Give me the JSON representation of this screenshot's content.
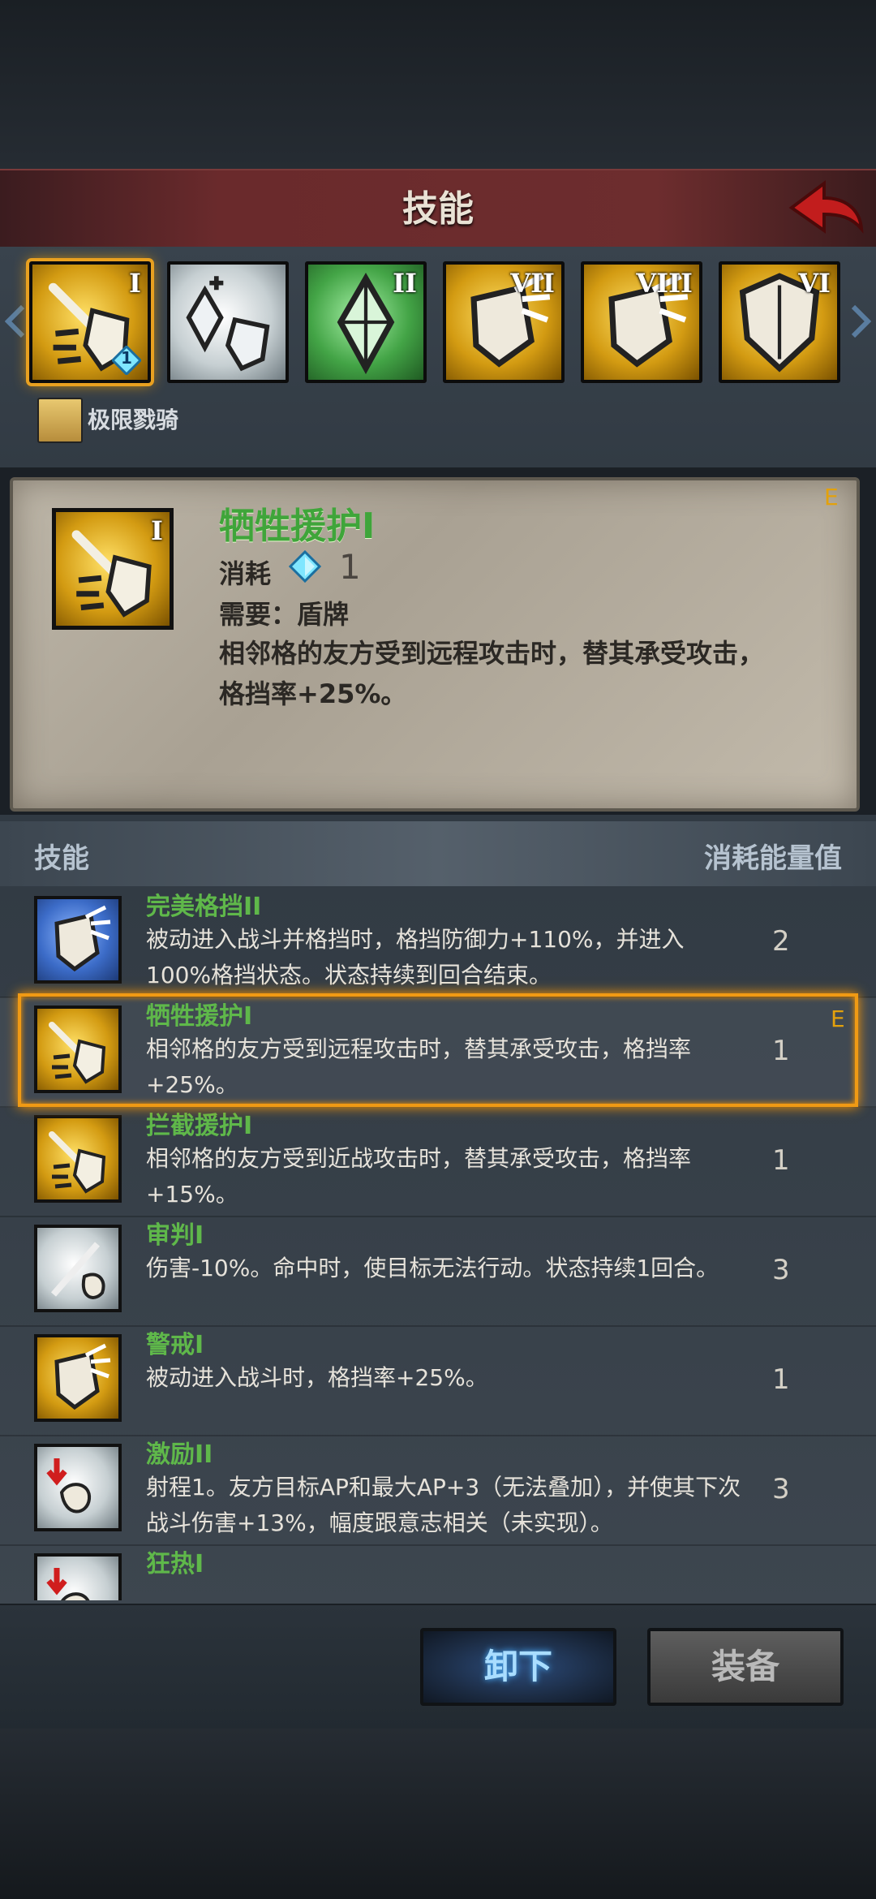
{
  "header": {
    "title": "技能"
  },
  "skill_slots": [
    {
      "roman": "I",
      "color": "yellow",
      "icon": "shield-slash-icon",
      "selected": true,
      "badge": "1"
    },
    {
      "roman": "",
      "color": "white",
      "icon": "crystal-shield-icon",
      "selected": false
    },
    {
      "roman": "II",
      "color": "green",
      "icon": "crystal-icon",
      "selected": false
    },
    {
      "roman": "VII",
      "color": "yellow",
      "icon": "shield-block-icon",
      "selected": false
    },
    {
      "roman": "VIII",
      "color": "yellow",
      "icon": "shield-block-icon",
      "selected": false
    },
    {
      "roman": "VI",
      "color": "yellow",
      "icon": "shield-icon",
      "selected": false
    }
  ],
  "character": {
    "name": "极限戮骑"
  },
  "detail": {
    "roman": "I",
    "name": "牺牲援护I",
    "grade": "E",
    "cost_label": "消耗",
    "cost_value": "1",
    "requirement": "需要：盾牌",
    "description": "相邻格的友方受到远程攻击时，替其承受攻击，格挡率+25%。"
  },
  "list_header": {
    "left": "技能",
    "right": "消耗能量值"
  },
  "skills": [
    {
      "name": "完美格挡II",
      "desc": "被动进入战斗并格挡时，格挡防御力+110%，并进入100%格挡状态。状态持续到回合结束。",
      "cost": "2",
      "color": "blue",
      "grade": ""
    },
    {
      "name": "牺牲援护I",
      "desc": "相邻格的友方受到远程攻击时，替其承受攻击，格挡率+25%。",
      "cost": "1",
      "color": "yellow",
      "grade": "E"
    },
    {
      "name": "拦截援护I",
      "desc": "相邻格的友方受到近战攻击时，替其承受攻击，格挡率+15%。",
      "cost": "1",
      "color": "yellow",
      "grade": ""
    },
    {
      "name": "审判I",
      "desc": "伤害-10%。命中时，使目标无法行动。状态持续1回合。",
      "cost": "3",
      "color": "white",
      "grade": ""
    },
    {
      "name": "警戒I",
      "desc": "被动进入战斗时，格挡率+25%。",
      "cost": "1",
      "color": "yellow",
      "grade": ""
    },
    {
      "name": "激励II",
      "desc": "射程1。友方目标AP和最大AP+3（无法叠加），并使其下次战斗伤害+13%，幅度跟意志相关（未实现）。",
      "cost": "3",
      "color": "white",
      "grade": ""
    },
    {
      "name": "狂热I",
      "desc": "",
      "cost": "",
      "color": "white",
      "grade": ""
    }
  ],
  "buttons": {
    "unequip": "卸下",
    "equip": "装备"
  },
  "colors": {
    "accent": "#f09a14",
    "skill_name": "#5fb84a",
    "header": "#6a2a2c"
  }
}
